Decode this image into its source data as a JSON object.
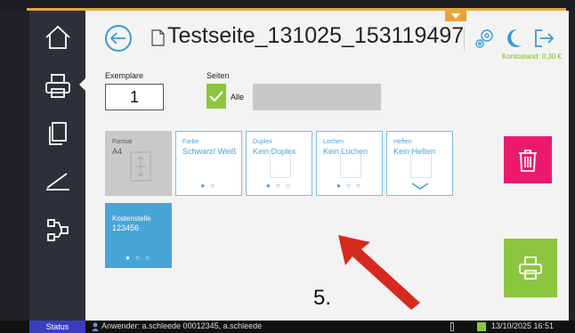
{
  "header": {
    "title": "Testseite_131025_153119497",
    "balance": "Kontostand: 0,30 €"
  },
  "sidebar": {
    "items": [
      {
        "icon": "home-icon"
      },
      {
        "icon": "printer-icon",
        "active": true
      },
      {
        "icon": "copy-icon"
      },
      {
        "icon": "scan-icon"
      },
      {
        "icon": "workflow-icon"
      }
    ]
  },
  "copies": {
    "label": "Exemplare",
    "value": "1"
  },
  "pages": {
    "label": "Seiten",
    "all_label": "Alle",
    "all_checked": true
  },
  "tiles": {
    "format": {
      "label": "Format",
      "value": "A4"
    },
    "color": {
      "label": "Farbe",
      "value": "Schwarz/ Weiß",
      "pages": 2,
      "selected": 1
    },
    "duplex": {
      "label": "Duplex",
      "value": "Kein Duplex",
      "pages": 3,
      "selected": 1
    },
    "punch": {
      "label": "Lochen",
      "value": "Kein Lochen",
      "pages": 3,
      "selected": 1
    },
    "staple": {
      "label": "Heften",
      "value": "Kein Heften"
    },
    "cost_center": {
      "label": "Kostenstelle",
      "value": "123456",
      "pages": 3,
      "selected": 1
    }
  },
  "annotation": {
    "step": "5."
  },
  "statusbar": {
    "status_label": "Status",
    "user": "Anwender: a.schleede 00012345, a.schleede",
    "datetime": "13/10/2025 16:51"
  },
  "colors": {
    "accent_blue": "#3a9bd5",
    "accent_green": "#8cc63f",
    "delete_pink": "#ec1a6e",
    "arrow_red": "#d62a1e",
    "top_orange": "#e8a33d"
  }
}
